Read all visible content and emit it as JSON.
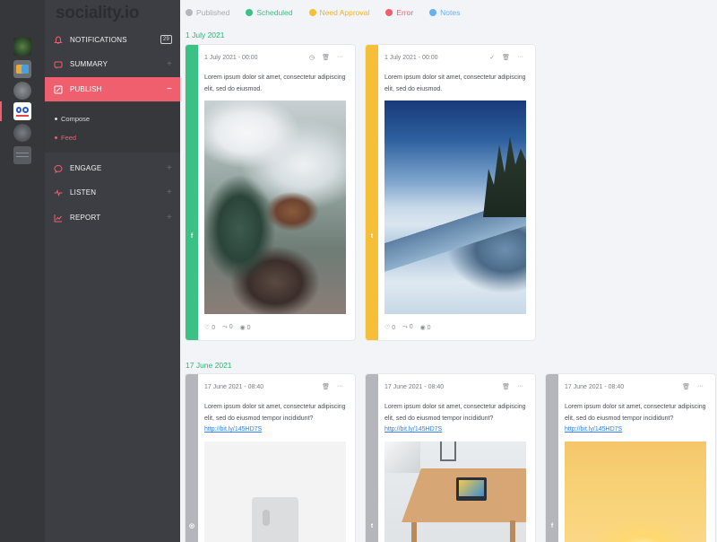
{
  "brand": {
    "logo_main": "sociality",
    "logo_suffix": ".io"
  },
  "sidebar": {
    "items": [
      {
        "label": "NOTIFICATIONS",
        "badge": "29"
      },
      {
        "label": "SUMMARY",
        "action": "+"
      },
      {
        "label": "PUBLISH",
        "action": "−"
      },
      {
        "label": "ENGAGE",
        "action": "+"
      },
      {
        "label": "LISTEN",
        "action": "+"
      },
      {
        "label": "REPORT",
        "action": "+"
      }
    ],
    "publish_sub": [
      {
        "label": "Compose"
      },
      {
        "label": "Feed"
      }
    ]
  },
  "legend": [
    {
      "label": "Published",
      "color": "#b4b6bb"
    },
    {
      "label": "Scheduled",
      "color": "#3ac183"
    },
    {
      "label": "Need Approval",
      "color": "#f7bf38"
    },
    {
      "label": "Error",
      "color": "#f05f6e"
    },
    {
      "label": "Notes",
      "color": "#67b1f2"
    }
  ],
  "groups": [
    {
      "date": "1 July 2021",
      "posts": [
        {
          "timestamp": "1 July 2021 - 00:00",
          "text": "Lorem ipsum dolor sit amet, consectetur adipiscing elit, sed do eiusmod.",
          "network": "f",
          "network_icon": "facebook-icon",
          "status_color": "#3ac183",
          "likes": "0",
          "shares": "0",
          "views": "0"
        },
        {
          "timestamp": "1 July 2021 - 00:00",
          "text": "Lorem ipsum dolor sit amet, consectetur adipiscing elit, sed do eiusmod.",
          "network": "t",
          "network_icon": "twitter-icon",
          "status_color": "#f7bf38",
          "likes": "0",
          "shares": "0",
          "views": "0"
        }
      ]
    },
    {
      "date": "17 June 2021",
      "posts": [
        {
          "timestamp": "17 June 2021 - 08:40",
          "text": "Lorem ipsum dolor sit amet, consectetur adipiscing elit, sed do eiusmod tempor incididunt?",
          "link": "http://bit.ly/145HD7S",
          "network": "◎",
          "network_icon": "instagram-icon",
          "status_color": "#b4b6bb"
        },
        {
          "timestamp": "17 June 2021 - 08:40",
          "text": "Lorem ipsum dolor sit amet, consectetur adipiscing elit, sed do eiusmod tempor incididunt?",
          "link": "http://bit.ly/145HD7S",
          "network": "t",
          "network_icon": "twitter-icon",
          "status_color": "#b4b6bb"
        },
        {
          "timestamp": "17 June 2021 - 08:40",
          "text": "Lorem ipsum dolor sit amet, consectetur adipiscing elit, sed do eiusmod tempor incididunt?",
          "link": "http://bit.ly/145HD7S",
          "network": "f",
          "network_icon": "facebook-icon",
          "status_color": "#b4b6bb"
        }
      ]
    }
  ]
}
